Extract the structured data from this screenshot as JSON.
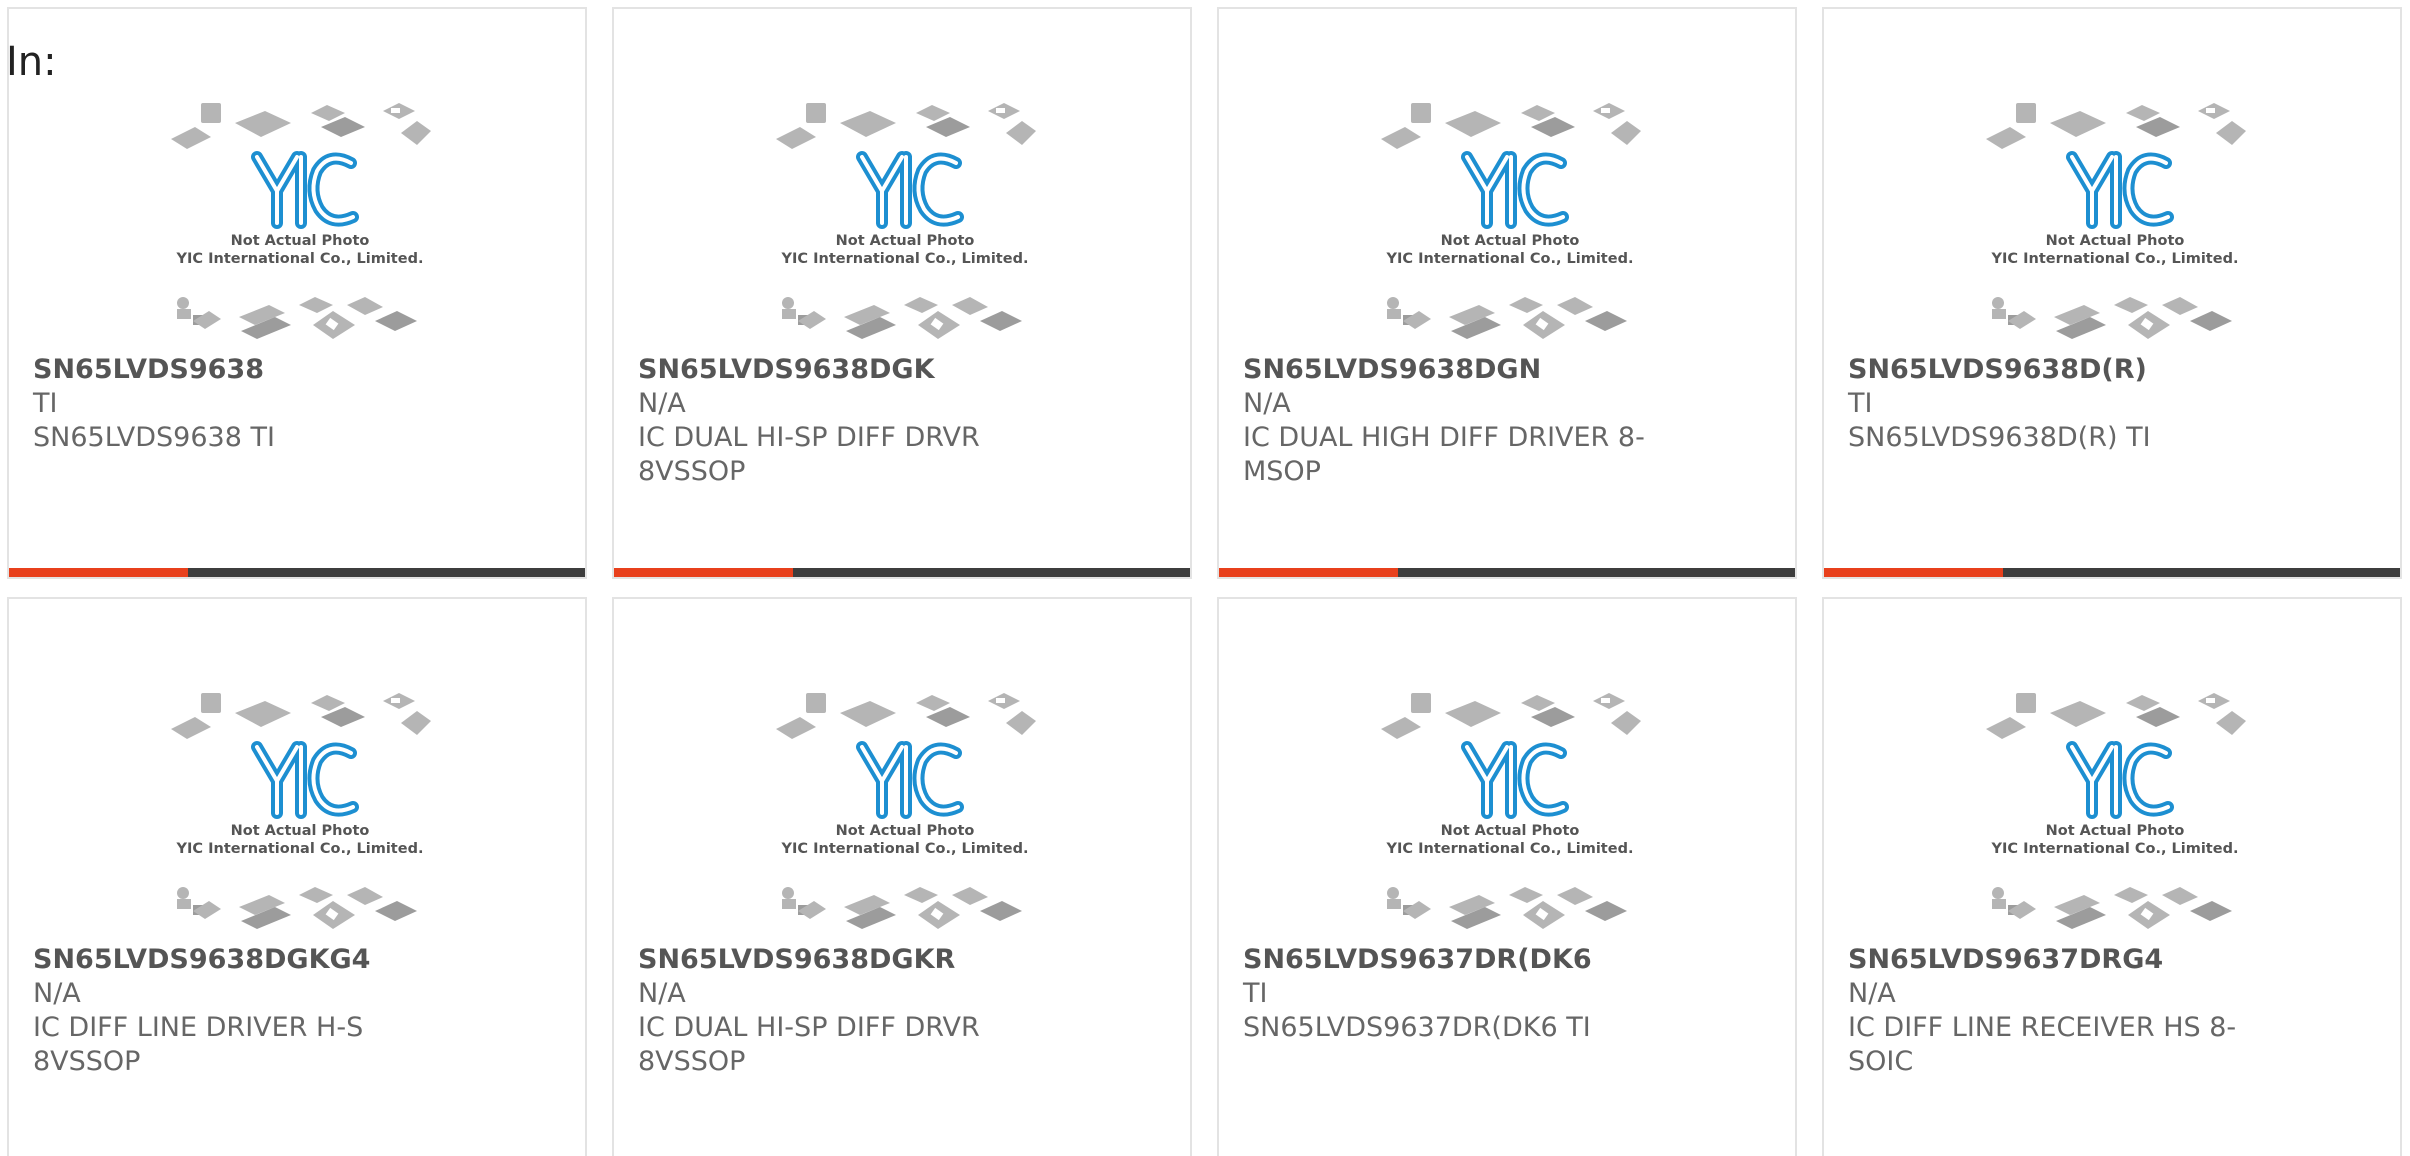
{
  "header": {
    "in_label": "In:"
  },
  "placeholder_image": {
    "line1": "Not Actual Photo",
    "line2": "YIC International Co., Limited.",
    "logo": "YIC",
    "colors": {
      "logo": "#1d8fd1",
      "chips": "#b5b5b5",
      "chips_dark": "#9c9c9c"
    }
  },
  "accent_color": "#e8401c",
  "bar_color": "#3d3d3d",
  "products": [
    {
      "part": "SN65LVDS9638",
      "brand": "TI",
      "desc": "SN65LVDS9638 TI",
      "progress": 0.31
    },
    {
      "part": "SN65LVDS9638DGK",
      "brand": "N/A",
      "desc": "IC DUAL HI-SP DIFF DRVR 8VSSOP",
      "progress": 0.31
    },
    {
      "part": "SN65LVDS9638DGN",
      "brand": "N/A",
      "desc": "IC DUAL HIGH DIFF DRIVER 8-MSOP",
      "progress": 0.31
    },
    {
      "part": "SN65LVDS9638D(R)",
      "brand": "TI",
      "desc": "SN65LVDS9638D(R) TI",
      "progress": 0.31
    },
    {
      "part": "SN65LVDS9638DGKG4",
      "brand": "N/A",
      "desc": "IC DIFF LINE DRIVER H-S 8VSSOP"
    },
    {
      "part": "SN65LVDS9638DGKR",
      "brand": "N/A",
      "desc": "IC DUAL HI-SP DIFF DRVR 8VSSOP"
    },
    {
      "part": "SN65LVDS9637DR(DK6",
      "brand": "TI",
      "desc": "SN65LVDS9637DR(DK6 TI"
    },
    {
      "part": "SN65LVDS9637DRG4",
      "brand": "N/A",
      "desc": "IC DIFF LINE RECEIVER HS 8-SOIC"
    }
  ]
}
